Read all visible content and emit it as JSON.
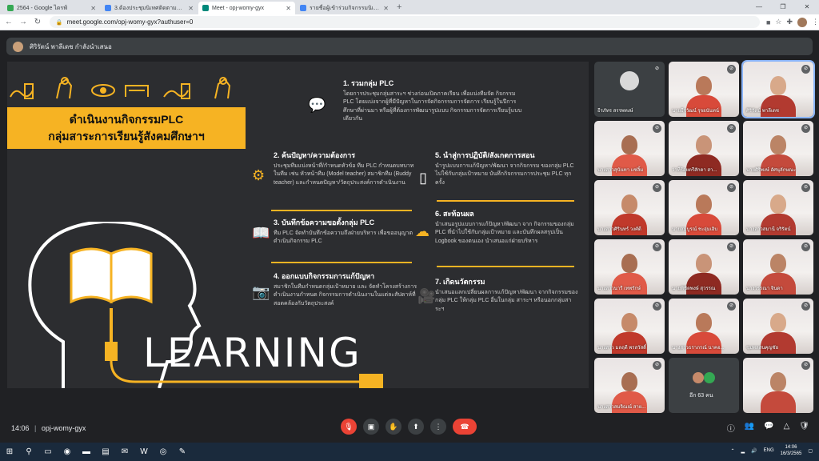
{
  "browser": {
    "tabs": [
      {
        "label": "2564 - Google ไดรฟ์",
        "color": "#34a853",
        "active": false
      },
      {
        "label": "3.ต้องประชุมนิเทศติดตามนิเทศผลงาน",
        "color": "#4285f4",
        "active": false
      },
      {
        "label": "Meet - opj-womy-gyx",
        "color": "#00897b",
        "active": true
      },
      {
        "label": "รายชื่อผู้เข้าร่วมกิจกรรมนิเทศติดตามผลงาน",
        "color": "#4285f4",
        "active": false
      }
    ],
    "new_tab": "+",
    "url": "meet.google.com/opj-womy-gyx?authuser=0"
  },
  "meet": {
    "presenting_text": "ศิริรัตน์ พาลีเดช กำลังนำเสนอ",
    "meeting_code": "opj-womy-gyx",
    "time": "14:06",
    "others_label": "อีก 63 คน"
  },
  "slide": {
    "title_line1": "ดำเนินงานกิจกรรมPLC",
    "title_line2": "กลุ่มสาระการเรียนรู้สังคมศึกษาฯ",
    "learning_word": "LEARNING",
    "sections": [
      {
        "title": "1. รวมกลุ่ม PLC",
        "body": "โดยการประชุมกลุ่มสาระฯ ช่วงก่อนเปิดภาคเรียน เพื่อแบ่งทีมจัด กิจกรรม PLC โดยแบ่งจากผู้ที่มีปัญหาในการจัดกิจกรรมการจัดการ เรียนรู้ในปีการศึกษาที่ผ่านมา หรือผู้ที่ต้องการพัฒนารูปแบบ กิจกรรมการจัดการเรียนรู้แบบเดียวกัน"
      },
      {
        "title": "2. ค้นปัญหา/ความต้องการ",
        "body": "ประชุมทีมแบ่งหน้าที่/กำหนดหัวข้อ ทีม PLC กำหนดบทบาทในทีม เช่น หัวหน้าทีม (Model teacher) สมาชิกทีม (Buddy teacher) และกำหนดปัญหา/วัตถุประสงค์การดำเนินงาน"
      },
      {
        "title": "3. บันทึกข้อความขอตั้งกลุ่ม PLC",
        "body": "ทีม PLC จัดทำบันทึกข้อความถึงฝ่ายบริหาร เพื่อขออนุญาตดำเนินกิจกรรม PLC"
      },
      {
        "title": "4. ออกแบบกิจกรรมการแก้ปัญหา",
        "body": "สมาชิกในทีมกำหนดกลุ่มเป้าหมาย และ จัดทำโครงสร้างการดำเนินงานกำหนด กิจกรรมการดำเนินงานในแต่ละสัปดาห์ที่ สอดคล้องกับวัตถุประสงค์"
      },
      {
        "title": "5. นำสู่การปฏิบัติ/สังเกตการสอน",
        "body": "นำรูปแบบการแก้ปัญหา/พัฒนา จากกิจกรรม ของกลุ่ม PLC ไปใช้กับกลุ่มเป้าหมาย บันทึกกิจกรรมการประชุม PLC ทุกครั้ง"
      },
      {
        "title": "6. สะท้อนผล",
        "body": "นำเสนอรูปแบบการแก้ปัญหา/พัฒนา จาก กิจกรรมของกลุ่ม PLC ที่นำไปใช้กับกลุ่มเป้าหมาย และบันทึกผลสรุปเป็น Logbook ของตนเอง นำเสนอแก่ฝ่ายบริหาร"
      },
      {
        "title": "7. เกิดนวัตกรรม",
        "body": "นำเสนอแลกเปลี่ยนผลการแก้ปัญหา/พัฒนา จากกิจกรรมของกลุ่ม PLC ให้กลุ่ม PLC อื่นในกลุ่ม สาระฯ หรือนอกกลุ่มสาระฯ"
      }
    ]
  },
  "participants": [
    {
      "name": "ธีรภัทร สรรพทงษ์",
      "kind": "avatar"
    },
    {
      "name": "นายธีรวัฒน์ รุจยนันทน์",
      "kind": "cam"
    },
    {
      "name": "ศิริรัตน์ พาลีเดช",
      "kind": "cam"
    },
    {
      "name": "นางสาวสุนันทา แซ่ลิ้ม",
      "kind": "cam"
    },
    {
      "name": "ว่าที่ร้อยตรีสักดา สา...",
      "kind": "cam"
    },
    {
      "name": "นายศิริพงษ์ อัศนุลักษณะ",
      "kind": "cam"
    },
    {
      "name": "นางสาวศิรินทร์ วงศ์ดี",
      "kind": "cam"
    },
    {
      "name": "นายสมบูรณ์ ชะอุ่มเอิบ",
      "kind": "cam"
    },
    {
      "name": "นางสาวสมานี จริรัตน์",
      "kind": "cam"
    },
    {
      "name": "นางสาวนารี เทพรักษ์",
      "kind": "cam"
    },
    {
      "name": "นายพิชิตพงษ์ สุวรรณ",
      "kind": "cam"
    },
    {
      "name": "นางวรรณา จินดา",
      "kind": "cam"
    },
    {
      "name": "นางสาว มลฤดี พรสวัสดิ์",
      "kind": "cam"
    },
    {
      "name": "นางสาวธราภรณ์ นาคอ...",
      "kind": "cam"
    },
    {
      "name": "ชุมพลสนคุญชัย",
      "kind": "cam"
    },
    {
      "name": "นางสาวสมจิณณ์ สาย...",
      "kind": "cam"
    },
    {
      "name": "",
      "kind": "others"
    },
    {
      "name": "",
      "kind": "cam"
    }
  ],
  "taskbar": {
    "lang": "ENG",
    "time": "14:06",
    "date": "16/3/2565"
  }
}
